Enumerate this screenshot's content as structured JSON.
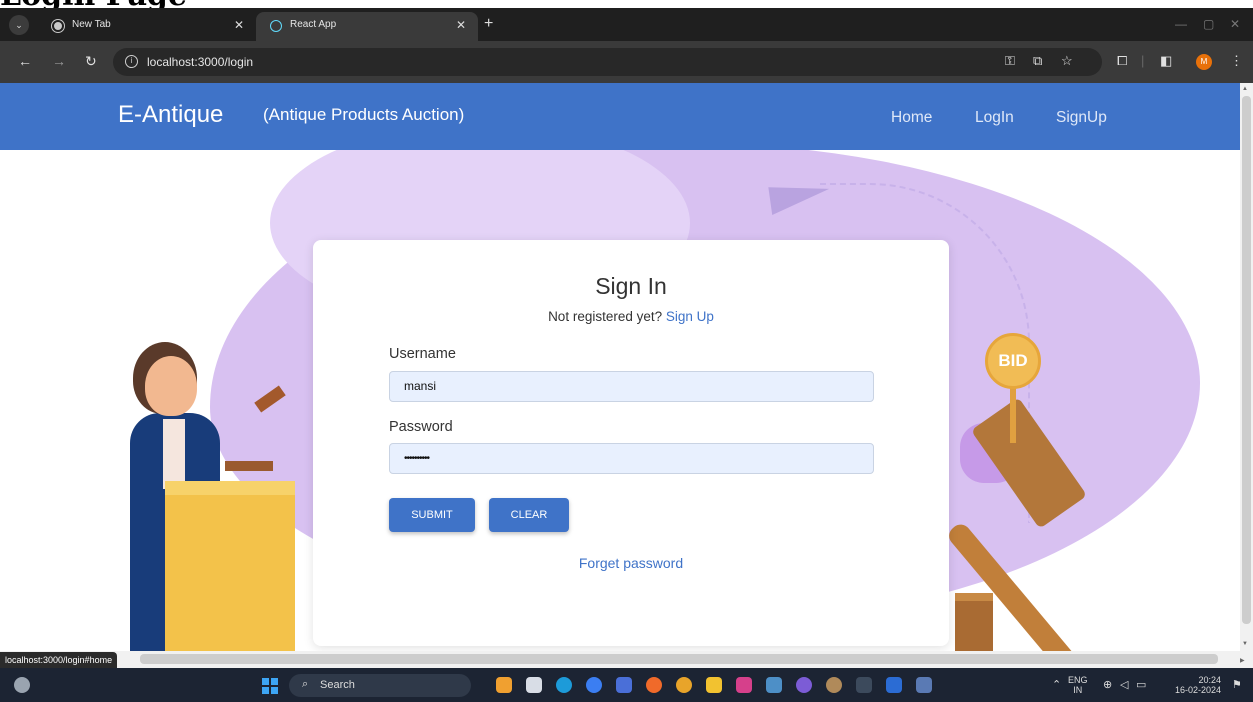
{
  "heading": {
    "text": "Login Page"
  },
  "browser": {
    "tabs": [
      {
        "title": "New Tab",
        "icon": "chrome-icon"
      },
      {
        "title": "React App",
        "icon": "react-icon"
      }
    ],
    "url": "localhost:3000/login",
    "status_url": "localhost:3000/login#home"
  },
  "navbar": {
    "brand": "E-Antique",
    "brand_sub": "(Antique Products Auction)",
    "links": [
      "Home",
      "LogIn",
      "SignUp"
    ]
  },
  "card": {
    "title": "Sign In",
    "subtitle": "Not registered yet?",
    "signup_link": "Sign Up",
    "username_label": "Username",
    "username_value": "mansi",
    "password_label": "Password",
    "password_value": "••••••••••",
    "submit_label": "SUBMIT",
    "clear_label": "CLEAR",
    "forget_label": "Forget password"
  },
  "illustration": {
    "bid_text": "BID"
  },
  "taskbar": {
    "search": "Search",
    "lang_top": "ENG",
    "lang_bottom": "IN",
    "time": "20:24",
    "date": "16-02-2024"
  },
  "colors": {
    "primary": "#3f73c8",
    "field": "#e8f0fe",
    "lavender": "#d8c1f1"
  }
}
